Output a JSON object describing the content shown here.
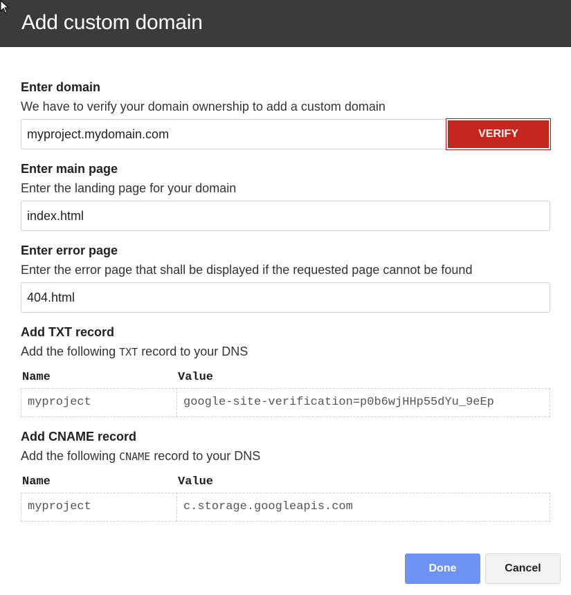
{
  "dialog": {
    "title": "Add custom domain"
  },
  "domain": {
    "heading": "Enter domain",
    "description": "We have to verify your domain ownership to add a custom domain",
    "value": "myproject.mydomain.com",
    "verify_label": "VERIFY"
  },
  "main_page": {
    "heading": "Enter main page",
    "description": "Enter the landing page for your domain",
    "value": "index.html"
  },
  "error_page": {
    "heading": "Enter error page",
    "description": "Enter the error page that shall be displayed if the requested page cannot be found",
    "value": "404.html"
  },
  "txt_record": {
    "heading": "Add TXT record",
    "description_before": "Add the following ",
    "description_code": "TXT",
    "description_after": " record to your DNS",
    "col_name": "Name",
    "col_value": "Value",
    "name": "myproject",
    "value": "google-site-verification=p0b6wjHHp55dYu_9eEp"
  },
  "cname_record": {
    "heading": "Add CNAME record",
    "description_before": "Add the following ",
    "description_code": "CNAME",
    "description_after": " record to your DNS",
    "col_name": "Name",
    "col_value": "Value",
    "name": "myproject",
    "value": "c.storage.googleapis.com"
  },
  "footer": {
    "done_label": "Done",
    "cancel_label": "Cancel"
  },
  "colors": {
    "titlebar": "#3b3b3b",
    "verify": "#c5271f",
    "done": "#6d94f5"
  },
  "icons": {
    "cursor": "move-cursor-icon"
  }
}
